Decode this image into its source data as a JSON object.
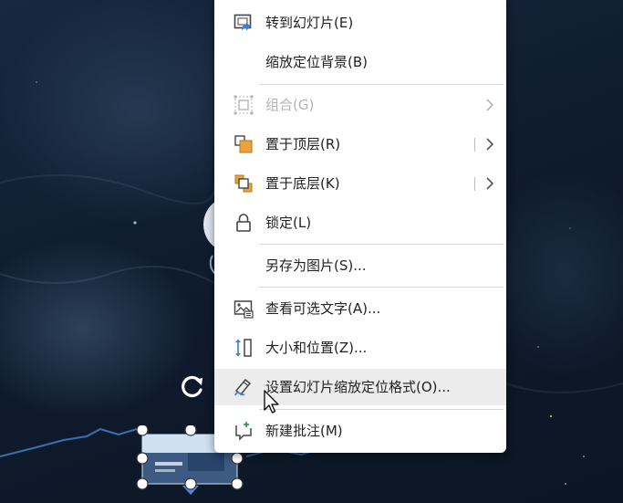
{
  "menu": {
    "items": [
      {
        "label": "转到幻灯片(E)",
        "icon": "go-to-slide-icon",
        "disabled": false,
        "submenu": false
      },
      {
        "label": "缩放定位背景(B)",
        "icon": "",
        "disabled": false,
        "submenu": false
      },
      {
        "label": "组合(G)",
        "icon": "group-icon",
        "disabled": true,
        "submenu": true
      },
      {
        "label": "置于顶层(R)",
        "icon": "bring-to-front-icon",
        "disabled": false,
        "submenu": true
      },
      {
        "label": "置于底层(K)",
        "icon": "send-to-back-icon",
        "disabled": false,
        "submenu": true
      },
      {
        "label": "锁定(L)",
        "icon": "lock-icon",
        "disabled": false,
        "submenu": false
      },
      {
        "label": "另存为图片(S)...",
        "icon": "",
        "disabled": false,
        "submenu": false
      },
      {
        "label": "查看可选文字(A)...",
        "icon": "alt-text-icon",
        "disabled": false,
        "submenu": false
      },
      {
        "label": "大小和位置(Z)...",
        "icon": "size-position-icon",
        "disabled": false,
        "submenu": false
      },
      {
        "label": "设置幻灯片缩放定位格式(O)...",
        "icon": "format-zoom-icon",
        "disabled": false,
        "submenu": false,
        "hovered": true
      },
      {
        "label": "新建批注(M)",
        "icon": "new-comment-icon",
        "disabled": false,
        "submenu": false
      }
    ]
  },
  "colors": {
    "menu_bg": "#ffffff",
    "hover_bg": "#ececec",
    "text": "#222222",
    "disabled_text": "#b3b3b3",
    "accent_orange": "#e8a33c",
    "slide_bg": "#0e1a2b"
  }
}
